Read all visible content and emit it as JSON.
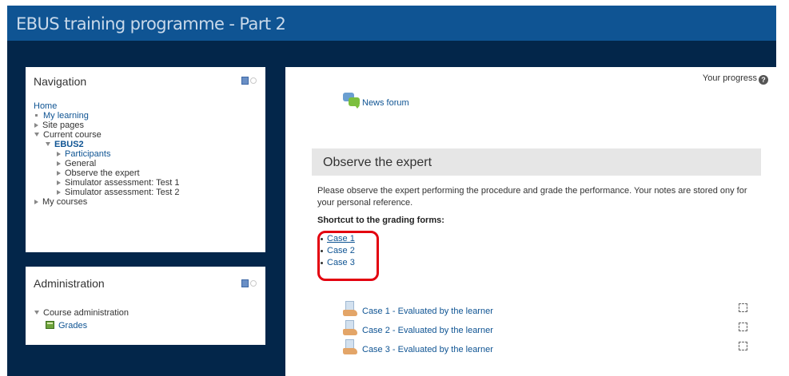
{
  "header": {
    "title": "EBUS training programme - Part 2"
  },
  "navigation": {
    "title": "Navigation",
    "home": "Home",
    "my_learning": "My learning",
    "site_pages": "Site pages",
    "current_course": "Current course",
    "course_code": "EBUS2",
    "course_items": [
      "Participants",
      "General",
      "Observe the expert",
      "Simulator assessment: Test 1",
      "Simulator assessment: Test 2"
    ],
    "my_courses": "My courses"
  },
  "administration": {
    "title": "Administration",
    "course_admin": "Course administration",
    "grades": "Grades"
  },
  "main": {
    "progress_label": "Your progress",
    "help_glyph": "?",
    "news_forum": "News forum",
    "section_title": "Observe the expert",
    "summary": "Please observe the expert performing the procedure and grade the performance. Your notes are stored ony for your personal reference.",
    "shortcut_heading": "Shortcut to the grading forms:",
    "shortcut_cases": [
      "Case 1",
      "Case 2",
      "Case 3"
    ],
    "activities": [
      {
        "label": "Case 1 - Evaluated by the learner"
      },
      {
        "label": "Case 2 - Evaluated by the learner"
      },
      {
        "label": "Case 3 - Evaluated by the learner"
      }
    ]
  },
  "colors": {
    "header_blue": "#0f5493",
    "dark_navy": "#03264a",
    "link_blue": "#0f5493",
    "highlight_red": "#e3000f"
  }
}
